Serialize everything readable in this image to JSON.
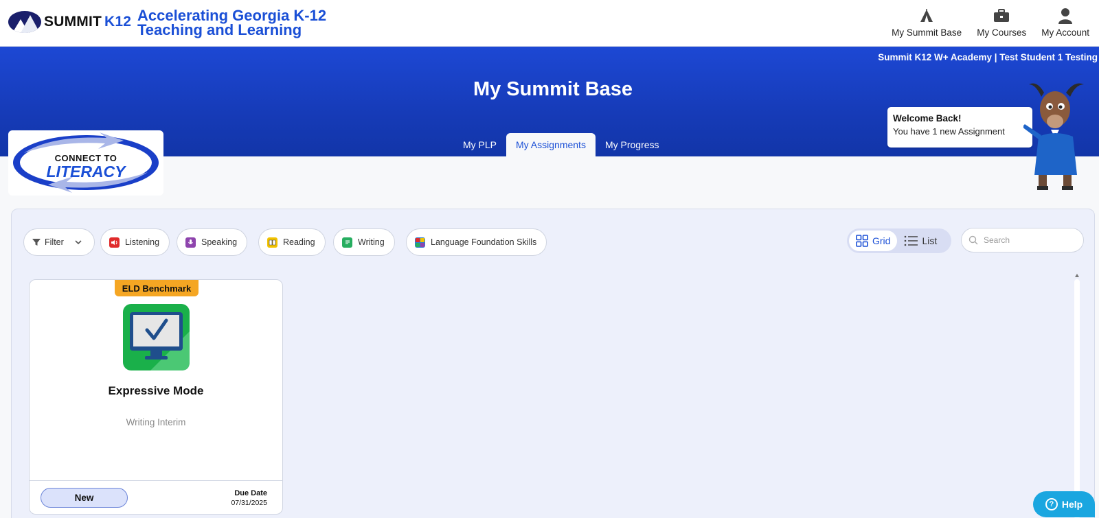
{
  "brand": {
    "name": "SUMMIT",
    "name_suffix": "K12",
    "tagline_line1": "Accelerating Georgia K-12",
    "tagline_line2": "Teaching and Learning",
    "accent": "#1a4fd6"
  },
  "topnav": [
    {
      "label": "My Summit Base",
      "icon": "tent-icon"
    },
    {
      "label": "My Courses",
      "icon": "briefcase-icon"
    },
    {
      "label": "My Account",
      "icon": "user-icon"
    }
  ],
  "banner": {
    "context": "Summit K12 W+ Academy | Test Student 1 Testing",
    "title": "My Summit Base"
  },
  "tabs": [
    {
      "label": "My PLP",
      "active": false
    },
    {
      "label": "My Assignments",
      "active": true
    },
    {
      "label": "My Progress",
      "active": false
    }
  ],
  "program_logo": {
    "line1": "CONNECT TO",
    "line2": "LITERACY"
  },
  "welcome": {
    "title": "Welcome Back!",
    "message": "You have 1 new Assignment"
  },
  "filters": {
    "filter_label": "Filter",
    "chips": [
      {
        "label": "Listening",
        "color": "#e02b2b"
      },
      {
        "label": "Speaking",
        "color": "#8e44ad"
      },
      {
        "label": "Reading",
        "color": "#f2c200"
      },
      {
        "label": "Writing",
        "color": "#27ae60"
      },
      {
        "label": "Language Foundation Skills",
        "color": "#2d7dd2"
      }
    ]
  },
  "view_toggle": {
    "grid_label": "Grid",
    "list_label": "List",
    "selected": "Grid"
  },
  "search": {
    "placeholder": "Search"
  },
  "assignments": [
    {
      "badge": "ELD Benchmark",
      "title": "Expressive Mode",
      "subtitle": "Writing Interim",
      "status": "New",
      "due_label": "Due Date",
      "due_date": "07/31/2025",
      "icon": "computer-check-icon"
    }
  ],
  "help": {
    "label": "Help"
  }
}
